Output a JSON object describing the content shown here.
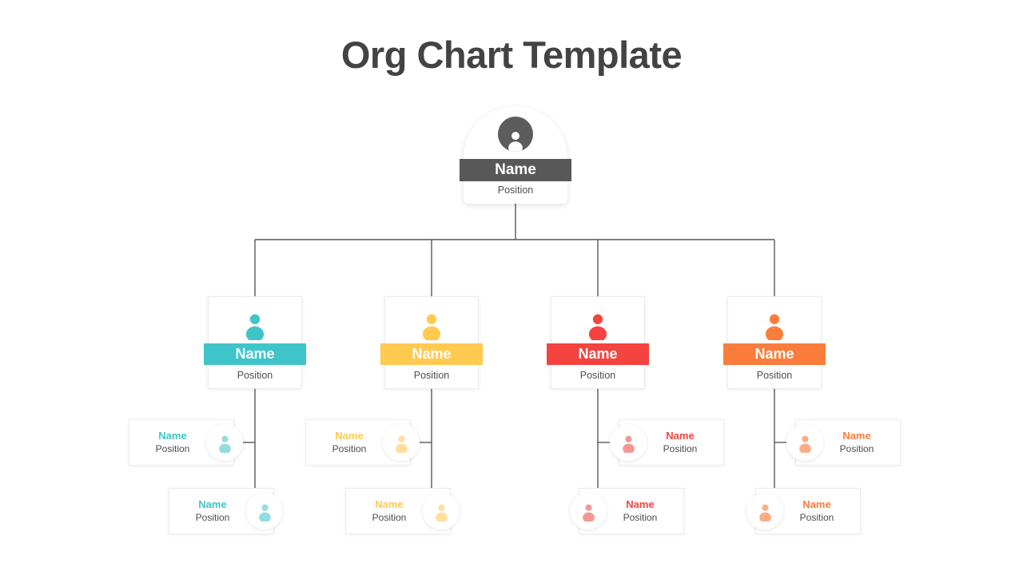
{
  "page": {
    "title": "Org Chart Template",
    "background": "#ffffff",
    "title_color": "#434343"
  },
  "colors": {
    "root": "#585858",
    "root_avatar": "#5c5c5c",
    "teal": "#3fc5c9",
    "teal_light": "#95dcde",
    "yellow": "#ffca4f",
    "yellow_light": "#ffdf9b",
    "red": "#f5433f",
    "red_light": "#f49793",
    "orange": "#fc7c3c",
    "orange_light": "#fbad86",
    "line": "#575757",
    "position_text": "#4d4d4d",
    "card_border": "#ededee"
  },
  "root": {
    "name": "Name",
    "position": "Position",
    "icon": "person-icon",
    "color": "#585858"
  },
  "branches": [
    {
      "id": "branch-1",
      "color": "#3fc5c9",
      "icon_tint": "#95dcde",
      "name": "Name",
      "position": "Position",
      "icon": "person-icon",
      "children": [
        {
          "name": "Name",
          "position": "Position",
          "icon": "person-icon"
        },
        {
          "name": "Name",
          "position": "Position",
          "icon": "person-icon"
        }
      ]
    },
    {
      "id": "branch-2",
      "color": "#ffca4f",
      "icon_tint": "#ffdf9b",
      "name": "Name",
      "position": "Position",
      "icon": "person-icon",
      "children": [
        {
          "name": "Name",
          "position": "Position",
          "icon": "person-icon"
        },
        {
          "name": "Name",
          "position": "Position",
          "icon": "person-icon"
        }
      ]
    },
    {
      "id": "branch-3",
      "color": "#f5433f",
      "icon_tint": "#f49793",
      "name": "Name",
      "position": "Position",
      "icon": "person-icon",
      "children": [
        {
          "name": "Name",
          "position": "Position",
          "icon": "person-icon"
        },
        {
          "name": "Name",
          "position": "Position",
          "icon": "person-icon"
        }
      ]
    },
    {
      "id": "branch-4",
      "color": "#fc7c3c",
      "icon_tint": "#fbad86",
      "name": "Name",
      "position": "Position",
      "icon": "person-icon",
      "children": [
        {
          "name": "Name",
          "position": "Position",
          "icon": "person-icon"
        },
        {
          "name": "Name",
          "position": "Position",
          "icon": "person-icon"
        }
      ]
    }
  ]
}
